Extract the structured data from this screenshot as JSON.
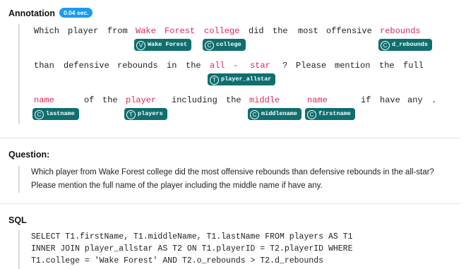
{
  "annotation": {
    "title": "Annotation",
    "badge": "0.04 sec.",
    "lines": [
      {
        "tokens": [
          "Which",
          "player",
          "from",
          "Wake",
          "Forest",
          "college",
          "did",
          "the",
          "most",
          "offensive",
          "rebounds"
        ]
      },
      {
        "tokens": [
          "than",
          "defensive",
          "rebounds",
          "in",
          "the",
          "all",
          "-",
          "star",
          "?",
          "Please",
          "mention",
          "the",
          "full"
        ]
      },
      {
        "tokens": [
          "name",
          "of",
          "the",
          "player",
          "including",
          "the",
          "middle",
          "name",
          "if",
          "have",
          "any",
          "."
        ]
      }
    ],
    "chips": [
      {
        "kind": "V",
        "label": "Wake Forest"
      },
      {
        "kind": "C",
        "label": "college"
      },
      {
        "kind": "C",
        "label": "d_rebounds"
      },
      {
        "kind": "T",
        "label": "player_allstar"
      },
      {
        "kind": "C",
        "label": "lastname"
      },
      {
        "kind": "T",
        "label": "players"
      },
      {
        "kind": "C",
        "label": "middlename"
      },
      {
        "kind": "C",
        "label": "firstname"
      }
    ]
  },
  "question": {
    "title": "Question:",
    "line1": "Which player from Wake Forest college did the most offensive rebounds than defensive rebounds in the all-star?",
    "line2": "Please mention the full name of the player including the middle name if have any."
  },
  "sql": {
    "title": "SQL",
    "line1": "SELECT T1.firstName, T1.middleName, T1.lastName FROM players AS T1",
    "line2": "INNER JOIN player_allstar AS T2 ON T1.playerID = T2.playerID WHERE",
    "line3": "T1.college = 'Wake Forest' AND T2.o_rebounds > T2.d_rebounds"
  },
  "colors": {
    "highlight": "#d92a5a",
    "chip": "#0f6e6e",
    "badge": "#1a9bf0"
  }
}
